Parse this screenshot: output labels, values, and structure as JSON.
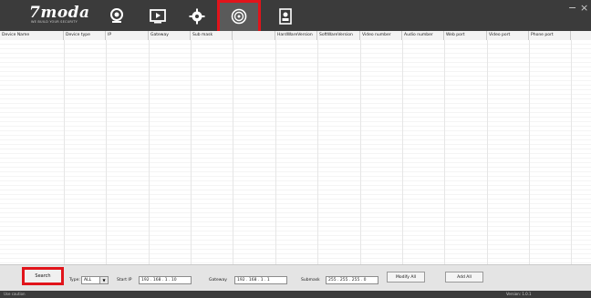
{
  "app": {
    "logo": "7moda",
    "logo_sub": "WE BUILD YOUR SECURITY"
  },
  "nav": {
    "items": [
      {
        "name": "live-view-icon"
      },
      {
        "name": "playback-icon"
      },
      {
        "name": "settings-icon"
      },
      {
        "name": "device-search-icon",
        "active": true
      },
      {
        "name": "user-icon"
      }
    ]
  },
  "window": {
    "minimize": "−",
    "close": "×"
  },
  "table": {
    "columns": [
      "Device Name",
      "Device type",
      "IP",
      "Gateway",
      "Sub mask",
      "",
      "HardWareVersion",
      "SoftWareVersion",
      "Video number",
      "Audio number",
      "Web port",
      "Video port",
      "Phone port"
    ]
  },
  "controls": {
    "search": "Search",
    "type_label": "Type:",
    "type_value": "ALL",
    "start_ip_label": "Start IP",
    "start_ip_value": "192 . 168 .  1  . 10",
    "gateway_label": "Gateway",
    "gateway_value": "192 . 168 .  1  .  1",
    "submask_label": "Submask",
    "submask_value": "255 . 255 . 255 .  0",
    "modify_all": "Modify All",
    "add_all": "Add All"
  },
  "status": {
    "left": "Use caution",
    "right": "Version: 1.0.1"
  },
  "colors": {
    "topbar": "#3b3b3b",
    "highlight": "#e1141b"
  }
}
